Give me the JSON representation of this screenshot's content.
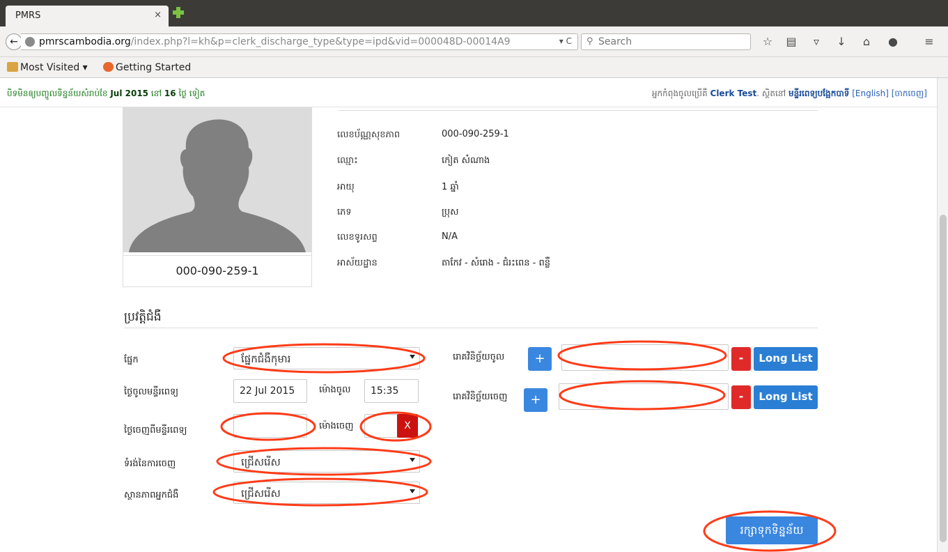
{
  "browser": {
    "tab_title": "PMRS",
    "tab_close": "×",
    "url_host": "pmrscambodia.org",
    "url_path": "/index.php?l=kh&p=clerk_discharge_type&type=ipd&vid=000048D-00014A9",
    "url_controls": "▾ C",
    "search_placeholder": "Search",
    "bookmarks": {
      "most_visited": "Most Visited ▾",
      "getting_started": "Getting Started"
    },
    "icons": [
      "back-icon",
      "lock-icon",
      "search-icon",
      "star-icon",
      "reader-icon",
      "pocket-icon",
      "download-icon",
      "home-icon",
      "chat-icon",
      "menu-icon"
    ]
  },
  "topline": {
    "left_prefix": "បិទមិនឲ្យបញ្ចូលទិន្នន័យសំរាប់ខែ",
    "left_month": "Jul 2015",
    "left_mid": "នៅ",
    "left_days": "16",
    "left_suffix": "ថ្ងៃ ទៀត",
    "right_prefix": "អ្នកកំពុងចូលប្រើគឺ",
    "right_user": "Clerk Test",
    "right_mid": ". ស្ថិតនៅ",
    "right_hospital": "មន្ទីរពេទ្យបង្អែកបាទី",
    "right_lang": "[English]",
    "right_logout": "[ចាកចេញ]"
  },
  "patient": {
    "photo_caption": "000-090-259-1",
    "fields": [
      {
        "label": "លេខប័ណ្ណសុខភាព",
        "value": "000-090-259-1"
      },
      {
        "label": "ឈ្មោះ",
        "value": "កៀត សំណាង"
      },
      {
        "label": "អាយុ",
        "value": "1 ឆ្នាំ"
      },
      {
        "label": "ភេទ",
        "value": "ប្រុស"
      },
      {
        "label": "លេខទូរសព្ទ",
        "value": "N/A"
      },
      {
        "label": "អាស័យដ្ឋាន",
        "value": "តាកែវ - សំរោង - ជំរះពេន - ពន្លឺ"
      }
    ]
  },
  "form": {
    "section_title": "ប្រវត្តិជំងឺ",
    "department_label": "ផ្នែក",
    "department_value": "ផ្នែកជំងឺកុមារ",
    "admit_date_label": "ថ្ងៃចូលមន្ទីរពេទ្យ",
    "admit_date_value": "22 Jul 2015",
    "admit_time_label": "ម៉ោងចូល",
    "admit_time_value": "15:35",
    "discharge_date_label": "ថ្ងៃចេញពីមន្ទីរពេទ្យ",
    "discharge_date_value": "",
    "discharge_time_label": "ម៉ោងចេញ",
    "discharge_time_value": "",
    "clear_label": "X",
    "discharge_type_label": "ទំរង់នៃការចេញ",
    "discharge_type_value": "ជ្រើសរើស",
    "patient_status_label": "ស្ថានភាពអ្នកជំងឺ",
    "patient_status_value": "ជ្រើសរើស",
    "diag_in_label": "រោគវិនិច្ឆ័យចូល",
    "diag_out_label": "រោគវិនិច្ឆ័យចេញ",
    "plus_label": "+",
    "minus_label": "-",
    "long_list_label": "Long List",
    "save_label": "រក្សាទុកទិន្នន័យ"
  },
  "colors": {
    "primary": "#3a87e0",
    "danger": "#e02a2a",
    "annotation": "#ff3b17"
  }
}
